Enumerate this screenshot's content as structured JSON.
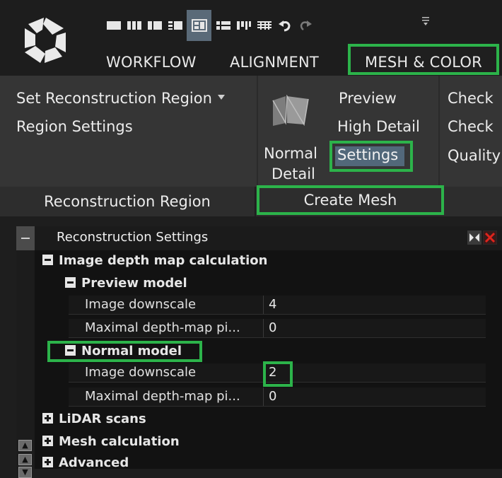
{
  "toolbar": {
    "logo_icon": "aperture-logo-icon",
    "icons": [
      "layout-1-icon",
      "layout-2-icon",
      "layout-3-icon",
      "layout-4-icon",
      "layout-5-icon",
      "layout-6-icon",
      "layout-7-icon",
      "layout-8-icon",
      "undo-icon",
      "redo-icon"
    ],
    "selected_icon_index": 4,
    "overflow_icon": "more-menu-icon"
  },
  "tabs": [
    {
      "label": "WORKFLOW"
    },
    {
      "label": "ALIGNMENT"
    },
    {
      "label": "MESH & COLOR"
    }
  ],
  "ribbon": {
    "set_region": "Set Reconstruction Region",
    "region_settings": "Region Settings",
    "preview": "Preview",
    "high_detail": "High Detail",
    "settings": "Settings",
    "normal_detail_line1": "Normal",
    "normal_detail_line2": "Detail",
    "check1": "Check",
    "check2": "Check",
    "quality": "Quality"
  },
  "groups": {
    "reconstruction_region": "Reconstruction Region",
    "create_mesh": "Create Mesh"
  },
  "panel": {
    "title": "Reconstruction Settings",
    "image_depth": "Image depth map calculation",
    "preview_model": "Preview model",
    "normal_model": "Normal model",
    "lidar": "LiDAR scans",
    "mesh_calc": "Mesh calculation",
    "advanced": "Advanced",
    "preview_props": [
      {
        "name": "Image downscale",
        "value": "4"
      },
      {
        "name": "Maximal depth-map pi...",
        "value": "0"
      }
    ],
    "normal_props": [
      {
        "name": "Image downscale",
        "value": "2"
      },
      {
        "name": "Maximal depth-map pi...",
        "value": "0"
      }
    ]
  },
  "colors": {
    "highlight": "#2cb34a",
    "selected_bg": "#52687a",
    "close_red": "#e0241c"
  }
}
